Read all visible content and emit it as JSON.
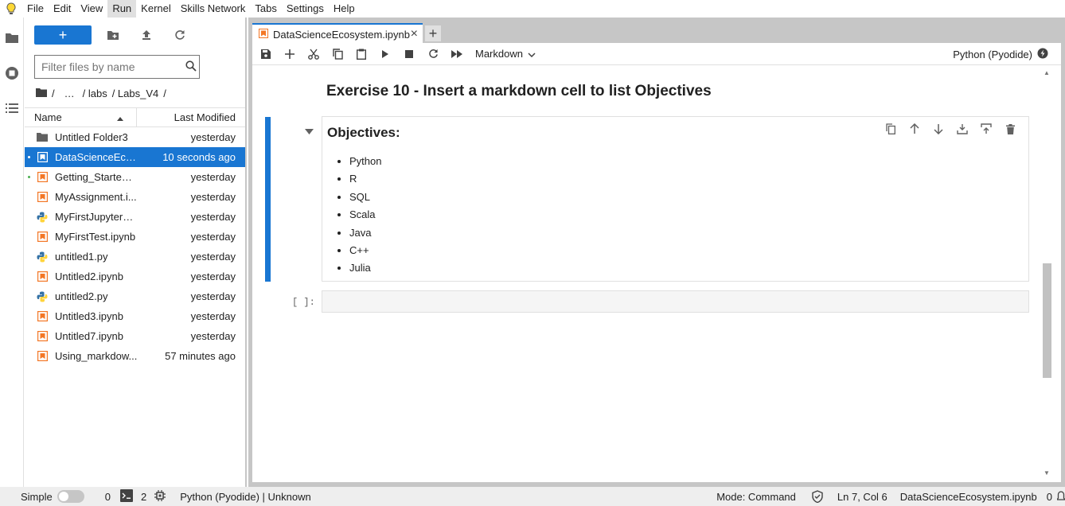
{
  "menu": [
    "File",
    "Edit",
    "View",
    "Run",
    "Kernel",
    "Skills Network",
    "Tabs",
    "Settings",
    "Help"
  ],
  "filebrowser": {
    "new_label": "+",
    "filter_placeholder": "Filter files by name",
    "breadcrumbs": [
      "/",
      "…",
      "/ labs",
      "/ Labs_V4",
      "/"
    ],
    "col_name": "Name",
    "col_modified": "Last Modified",
    "files": [
      {
        "name": "Untitled Folder3",
        "modified": "yesterday",
        "icon": "folder-icon",
        "running": false
      },
      {
        "name": "DataScienceEco...",
        "modified": "10 seconds ago",
        "icon": "notebook-icon",
        "running": true
      },
      {
        "name": "Getting_Started_...",
        "modified": "yesterday",
        "icon": "notebook-icon",
        "running": true
      },
      {
        "name": "MyAssignment.i...",
        "modified": "yesterday",
        "icon": "notebook-icon",
        "running": false
      },
      {
        "name": "MyFirstJupyterS...",
        "modified": "yesterday",
        "icon": "python-icon",
        "running": false
      },
      {
        "name": "MyFirstTest.ipynb",
        "modified": "yesterday",
        "icon": "notebook-icon",
        "running": false
      },
      {
        "name": "untitled1.py",
        "modified": "yesterday",
        "icon": "python-icon",
        "running": false
      },
      {
        "name": "Untitled2.ipynb",
        "modified": "yesterday",
        "icon": "notebook-icon",
        "running": false
      },
      {
        "name": "untitled2.py",
        "modified": "yesterday",
        "icon": "python-icon",
        "running": false
      },
      {
        "name": "Untitled3.ipynb",
        "modified": "yesterday",
        "icon": "notebook-icon",
        "running": false
      },
      {
        "name": "Untitled7.ipynb",
        "modified": "yesterday",
        "icon": "notebook-icon",
        "running": false
      },
      {
        "name": "Using_markdow...",
        "modified": "57 minutes ago",
        "icon": "notebook-icon",
        "running": false
      }
    ]
  },
  "tab": {
    "label": "DataScienceEcosystem.ipynb",
    "close": "×",
    "add": "+"
  },
  "toolbar": {
    "cell_type": "Markdown",
    "kernel": "Python (Pyodide)"
  },
  "notebook": {
    "exercise_heading": "Exercise 10 - Insert a markdown cell to list Objectives",
    "md_title": "Objectives:",
    "objectives": [
      "Python",
      "R",
      "SQL",
      "Scala",
      "Java",
      "C++",
      "Julia"
    ],
    "prompt": "[ ]:"
  },
  "status": {
    "simple": "Simple",
    "count0": "0",
    "terminals": "2",
    "kernel_status": "Python (Pyodide) | Unknown",
    "mode": "Mode: Command",
    "position": "Ln 7, Col 6",
    "filename": "DataScienceEcosystem.ipynb",
    "notifications": "0"
  },
  "colors": {
    "accent": "#1976d2",
    "notebook_orange": "#f37726",
    "python_blue": "#3572a5",
    "python_yellow": "#ffd43b"
  }
}
